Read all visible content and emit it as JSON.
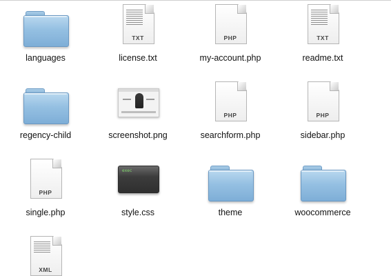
{
  "files": [
    {
      "name": "languages",
      "icon": "folder-icon"
    },
    {
      "name": "license.txt",
      "icon": "document-icon",
      "badge": "TXT"
    },
    {
      "name": "my-account.php",
      "icon": "document-icon",
      "badge": "PHP"
    },
    {
      "name": "readme.txt",
      "icon": "document-icon",
      "badge": "TXT"
    },
    {
      "name": "regency-child",
      "icon": "folder-icon"
    },
    {
      "name": "screenshot.png",
      "icon": "image-thumbnail-icon"
    },
    {
      "name": "searchform.php",
      "icon": "document-icon",
      "badge": "PHP"
    },
    {
      "name": "sidebar.php",
      "icon": "document-icon",
      "badge": "PHP"
    },
    {
      "name": "single.php",
      "icon": "document-icon",
      "badge": "PHP"
    },
    {
      "name": "style.css",
      "icon": "exec-icon",
      "badge": "exec"
    },
    {
      "name": "theme",
      "icon": "folder-icon"
    },
    {
      "name": "woocommerce",
      "icon": "folder-icon"
    },
    {
      "name": "",
      "icon": "document-icon",
      "badge": "XML"
    }
  ],
  "colors": {
    "folder": "#95c0e2",
    "label_text": "#111111",
    "exec_text": "#7fd86a"
  }
}
